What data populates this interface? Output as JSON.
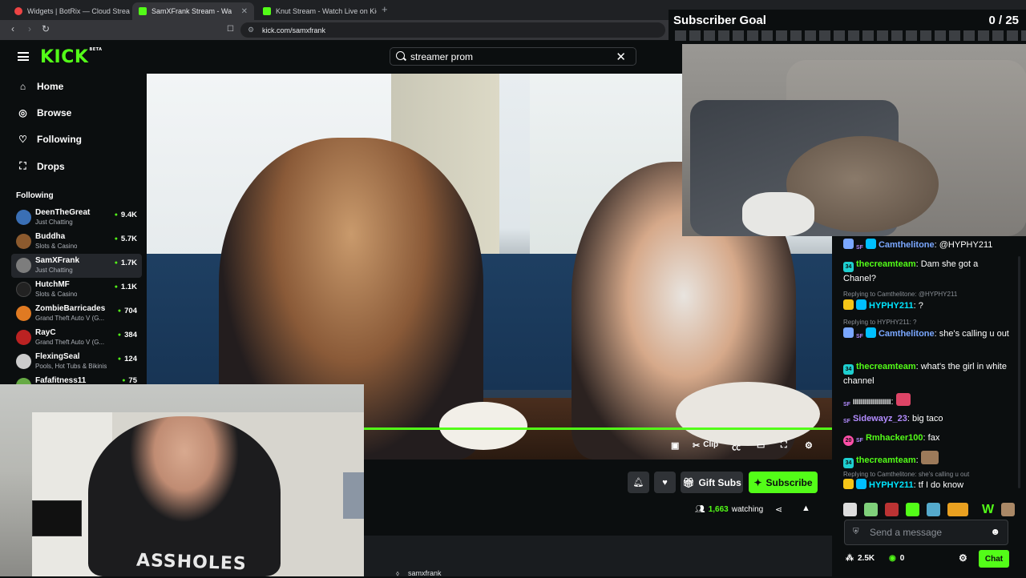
{
  "browser": {
    "tabs": [
      {
        "label": "Widgets | BotRix — Cloud Streaming",
        "favicon_color": "#e44"
      },
      {
        "label": "SamXFrank Stream - Watch Live on Kick",
        "favicon_color": "#53fc18"
      },
      {
        "label": "Knut Stream - Watch Live on Kick",
        "favicon_color": "#53fc18"
      }
    ],
    "url": "kick.com/samxfrank"
  },
  "kick": {
    "logo": "KICK",
    "logo_badge": "BETA",
    "search_value": "streamer prom",
    "accent": "#53fc18"
  },
  "sidebar": {
    "nav": [
      {
        "label": "Home",
        "icon": "home-icon"
      },
      {
        "label": "Browse",
        "icon": "compass-icon"
      },
      {
        "label": "Following",
        "icon": "heart-icon"
      },
      {
        "label": "Drops",
        "icon": "gift-icon"
      }
    ],
    "following_title": "Following",
    "channels": [
      {
        "name": "DeenTheGreat",
        "category": "Just Chatting",
        "viewers": "9.4K",
        "avatar": "#3a6fb5"
      },
      {
        "name": "Buddha",
        "category": "Slots & Casino",
        "viewers": "5.7K",
        "avatar": "#8c5a2e"
      },
      {
        "name": "SamXFrank",
        "category": "Just Chatting",
        "viewers": "1.7K",
        "avatar": "#7d7d7d"
      },
      {
        "name": "HutchMF",
        "category": "Slots & Casino",
        "viewers": "1.1K",
        "avatar": "#222"
      },
      {
        "name": "ZombieBarricades",
        "category": "Grand Theft Auto V (G...",
        "viewers": "704",
        "avatar": "#e07a22"
      },
      {
        "name": "RayC",
        "category": "Grand Theft Auto V (G...",
        "viewers": "384",
        "avatar": "#b22"
      },
      {
        "name": "FlexingSeal",
        "category": "Pools, Hot Tubs & Bikinis",
        "viewers": "124",
        "avatar": "#ccc"
      },
      {
        "name": "Fafafitness11",
        "category": "",
        "viewers": "75",
        "avatar": "#6a4"
      }
    ]
  },
  "player": {
    "clip_label": "Clip"
  },
  "stream_actions": {
    "gift_subs": "Gift Subs",
    "subscribe": "Subscribe",
    "watching_count": "1,663",
    "watching_label": "watching",
    "tag": "samxfrank"
  },
  "webcam": {
    "shirt_text": "ASSHOLES"
  },
  "subscriber_goal": {
    "title": "Subscriber Goal",
    "count": "0 / 25",
    "current": 0,
    "target": 25
  },
  "chat": {
    "messages": [
      {
        "user": "Camthelitone",
        "color": "#7aa7ff",
        "text": "@HYPHY211"
      },
      {
        "user": "thecreamteam",
        "color": "#53fc18",
        "text": "Dam she got a Chanel?"
      },
      {
        "reply": "Replying to Camthelitone: @HYPHY211"
      },
      {
        "user": "HYPHY211",
        "color": "#00e5ff",
        "text": "?"
      },
      {
        "reply": "Replying to HYPHY211: ?"
      },
      {
        "user": "Camthelitone",
        "color": "#7aa7ff",
        "text": "she's calling u out"
      },
      {
        "user": "thecreamteam",
        "color": "#53fc18",
        "text": "what's the girl in white channel"
      },
      {
        "user": "IIIIIIIIIIIIIIIIIII",
        "color": "#fff",
        "text": ""
      },
      {
        "user": "Sidewayz_23",
        "color": "#b38cff",
        "text": "big taco"
      },
      {
        "user": "Rmhacker100",
        "color": "#53fc18",
        "text": "fax"
      },
      {
        "user": "thecreamteam",
        "color": "#53fc18",
        "text": ""
      },
      {
        "reply": "Replying to Camthelitone: she's calling u out"
      },
      {
        "user": "HYPHY211",
        "color": "#00e5ff",
        "text": "tf I do know"
      }
    ],
    "badges": {
      "sub34": "34",
      "sub20": "20",
      "sf": "SF"
    },
    "input_placeholder": "Send a message",
    "followers": "2.5K",
    "points": "0",
    "send_label": "Chat"
  }
}
